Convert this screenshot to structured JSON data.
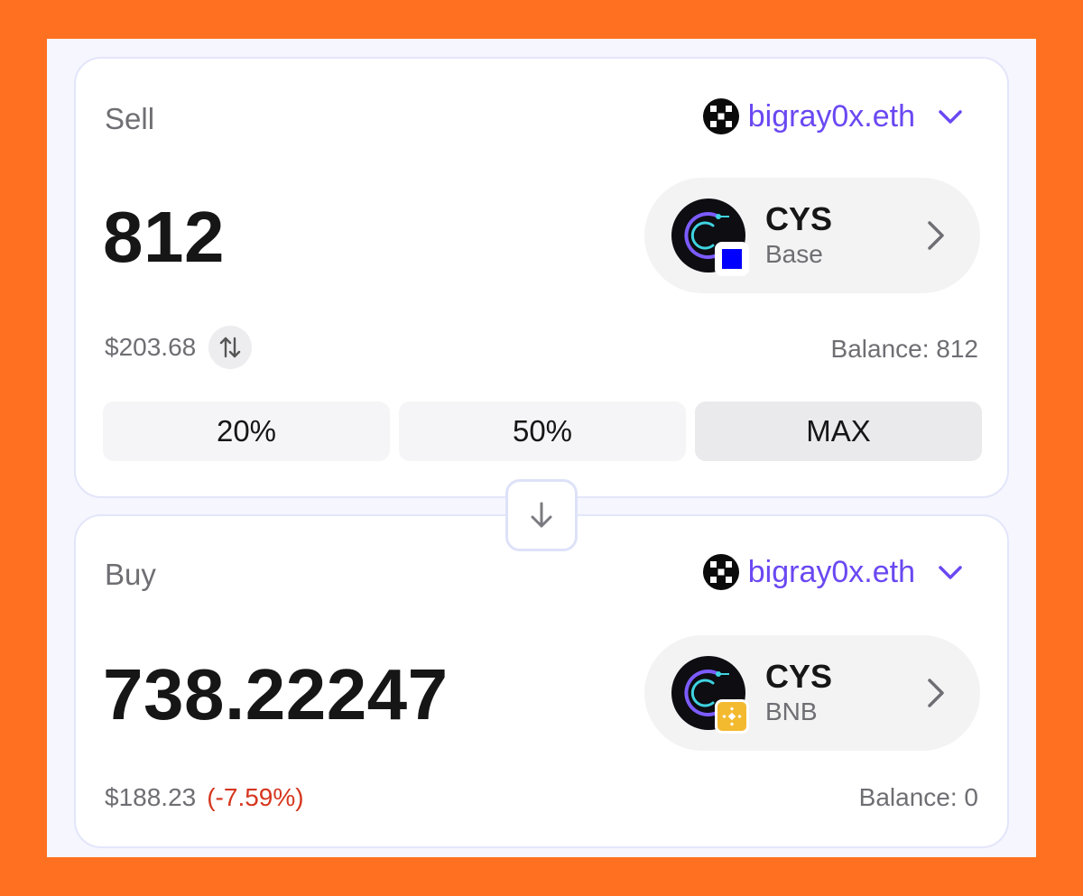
{
  "sell": {
    "label": "Sell",
    "account": "bigray0x.eth",
    "amount": "812",
    "token": {
      "symbol": "CYS",
      "chain": "Base",
      "chain_icon": "base-chain-icon"
    },
    "usd_value": "$203.68",
    "balance": "Balance: 812",
    "percent_buttons": [
      "20%",
      "50%",
      "MAX"
    ]
  },
  "buy": {
    "label": "Buy",
    "account": "bigray0x.eth",
    "amount": "738.22247",
    "token": {
      "symbol": "CYS",
      "chain": "BNB",
      "chain_icon": "bnb-chain-icon"
    },
    "usd_value": "$188.23",
    "price_impact": "(-7.59%)",
    "balance": "Balance: 0"
  },
  "colors": {
    "background": "#FF7120",
    "accent": "#6A48F2",
    "negative": "#D6361F",
    "base_chain": "#0000FF",
    "bnb_chain": "#F3BA2F"
  }
}
